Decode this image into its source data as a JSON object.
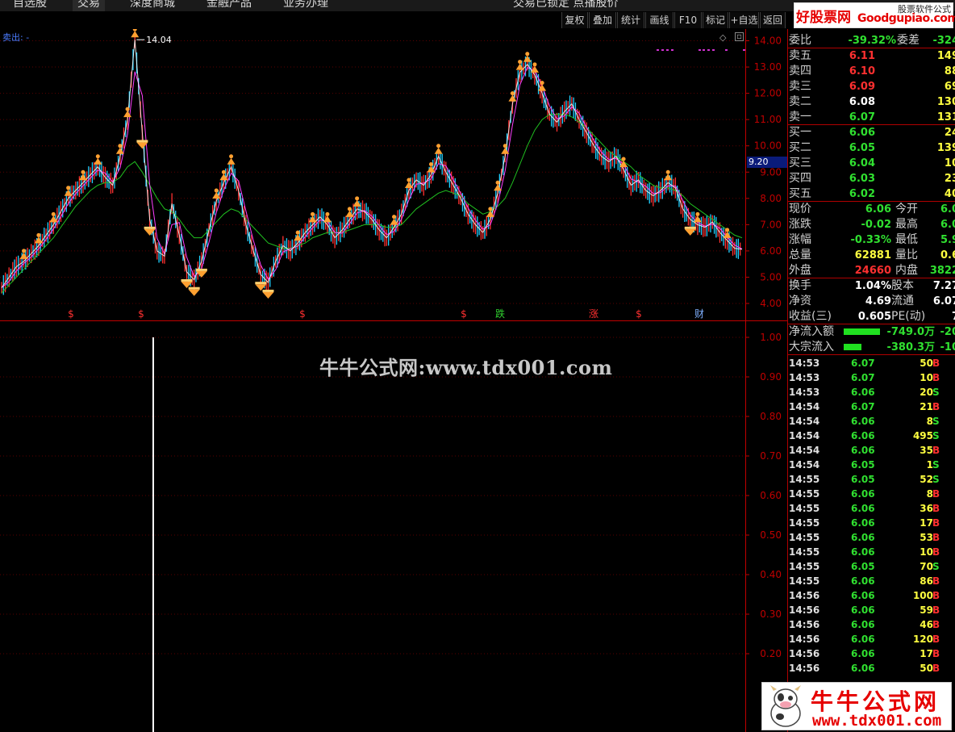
{
  "top_bar": {
    "tabs": [
      "自选股",
      "交易",
      "深度商城",
      "金融产品",
      "业务办理"
    ],
    "window_title": "交易已锁定   点播股价"
  },
  "toolbar": {
    "buttons": [
      "复权",
      "叠加",
      "统计",
      "画线",
      "F10",
      "标记",
      "+自选",
      "返回"
    ]
  },
  "main_chart": {
    "indicator_label": "卖出: -",
    "peak_label": "14.04",
    "current_price_tag": "9.20",
    "y_ticks": [
      "14.00",
      "13.00",
      "12.00",
      "11.00",
      "10.00",
      "9.00",
      "8.00",
      "7.00",
      "6.00",
      "5.00",
      "4.00"
    ],
    "event_markers": [
      {
        "label": "$",
        "color": "#ff3030"
      },
      {
        "label": "$",
        "color": "#ff3030"
      },
      {
        "label": "$",
        "color": "#ff3030"
      },
      {
        "label": "$",
        "color": "#ff3030"
      },
      {
        "label": "跌",
        "color": "#30d030"
      },
      {
        "label": "涨",
        "color": "#ff3030"
      },
      {
        "label": "$",
        "color": "#ff3030"
      },
      {
        "label": "财",
        "color": "#7fb0ff"
      }
    ]
  },
  "lower_chart": {
    "y_ticks": [
      "1.00",
      "0.90",
      "0.80",
      "0.70",
      "0.60",
      "0.50",
      "0.40",
      "0.30",
      "0.20"
    ]
  },
  "watermark": "牛牛公式网:www.tdx001.com",
  "logos": {
    "top_main": "好股票网",
    "top_site": "Goodgupiao.com",
    "top_tag": "股票软件公式",
    "bottom_main": "牛牛公式网",
    "bottom_site": "www.tdx001.com"
  },
  "quote": {
    "weibi": {
      "label": "委比",
      "value": "-39.32%",
      "label2": "委差",
      "value2": "-324"
    },
    "asks": [
      {
        "label": "卖五",
        "price": "6.11",
        "vol": "149"
      },
      {
        "label": "卖四",
        "price": "6.10",
        "vol": "88"
      },
      {
        "label": "卖三",
        "price": "6.09",
        "vol": "69"
      },
      {
        "label": "卖二",
        "price": "6.08",
        "vol": "130"
      },
      {
        "label": "卖一",
        "price": "6.07",
        "vol": "131"
      }
    ],
    "bids": [
      {
        "label": "买一",
        "price": "6.06",
        "vol": "24"
      },
      {
        "label": "买二",
        "price": "6.05",
        "vol": "139"
      },
      {
        "label": "买三",
        "price": "6.04",
        "vol": "10"
      },
      {
        "label": "买四",
        "price": "6.03",
        "vol": "23"
      },
      {
        "label": "买五",
        "price": "6.02",
        "vol": "40"
      }
    ],
    "stats": [
      {
        "l1": "现价",
        "v1": "6.06",
        "l2": "今开",
        "v2": "6.0"
      },
      {
        "l1": "涨跌",
        "v1": "-0.02",
        "l2": "最高",
        "v2": "6.0"
      },
      {
        "l1": "涨幅",
        "v1": "-0.33%",
        "l2": "最低",
        "v2": "5.9"
      },
      {
        "l1": "总量",
        "v1": "62881",
        "l2": "量比",
        "v2": "0.6"
      },
      {
        "l1": "外盘",
        "v1": "24660",
        "l2": "内盘",
        "v2": "3822"
      }
    ],
    "stats2": [
      {
        "l1": "换手",
        "v1": "1.04%",
        "l2": "股本",
        "v2": "7.27"
      },
      {
        "l1": "净资",
        "v1": "4.69",
        "l2": "流通",
        "v2": "6.07"
      },
      {
        "l1": "收益(三)",
        "v1": "0.605",
        "l2": "PE(动)",
        "v2": "7"
      }
    ],
    "flows": [
      {
        "label": "净流入额",
        "value": "-749.0万",
        "extra": "-20"
      },
      {
        "label": "大宗流入",
        "value": "-380.3万",
        "extra": "-10"
      }
    ]
  },
  "ticks": [
    {
      "time": "14:53",
      "price": "6.07",
      "vol": "50",
      "side": "B"
    },
    {
      "time": "14:53",
      "price": "6.07",
      "vol": "10",
      "side": "B"
    },
    {
      "time": "14:53",
      "price": "6.06",
      "vol": "20",
      "side": "S"
    },
    {
      "time": "14:54",
      "price": "6.07",
      "vol": "21",
      "side": "B"
    },
    {
      "time": "14:54",
      "price": "6.06",
      "vol": "8",
      "side": "S"
    },
    {
      "time": "14:54",
      "price": "6.06",
      "vol": "495",
      "side": "S"
    },
    {
      "time": "14:54",
      "price": "6.06",
      "vol": "35",
      "side": "B"
    },
    {
      "time": "14:54",
      "price": "6.05",
      "vol": "1",
      "side": "S"
    },
    {
      "time": "14:55",
      "price": "6.05",
      "vol": "52",
      "side": "S"
    },
    {
      "time": "14:55",
      "price": "6.06",
      "vol": "8",
      "side": "B"
    },
    {
      "time": "14:55",
      "price": "6.06",
      "vol": "36",
      "side": "B"
    },
    {
      "time": "14:55",
      "price": "6.06",
      "vol": "17",
      "side": "B"
    },
    {
      "time": "14:55",
      "price": "6.06",
      "vol": "53",
      "side": "B"
    },
    {
      "time": "14:55",
      "price": "6.06",
      "vol": "10",
      "side": "B"
    },
    {
      "time": "14:55",
      "price": "6.05",
      "vol": "70",
      "side": "S"
    },
    {
      "time": "14:55",
      "price": "6.06",
      "vol": "86",
      "side": "B"
    },
    {
      "time": "14:56",
      "price": "6.06",
      "vol": "100",
      "side": "B"
    },
    {
      "time": "14:56",
      "price": "6.06",
      "vol": "59",
      "side": "B"
    },
    {
      "time": "14:56",
      "price": "6.06",
      "vol": "46",
      "side": "B"
    },
    {
      "time": "14:56",
      "price": "6.06",
      "vol": "120",
      "side": "B"
    },
    {
      "time": "14:56",
      "price": "6.06",
      "vol": "17",
      "side": "B"
    },
    {
      "time": "14:56",
      "price": "6.06",
      "vol": "50",
      "side": "B"
    }
  ],
  "colors": {
    "up": "#ff3030",
    "down": "#30e030",
    "flat": "#ffffff",
    "buy": "#ff3030",
    "sell": "#30e030",
    "axis": "#c00000",
    "ma_green": "#20c020",
    "ma_pink": "#ff40ff",
    "ma_yellow": "#ffff30",
    "signal": "#ffa030"
  },
  "chart_data": {
    "type": "line",
    "title": "",
    "xlabel": "",
    "ylabel": "",
    "ylim": [
      4.0,
      14.2
    ],
    "grid": true,
    "series": [
      {
        "values": [
          4.6,
          5.0,
          5.4,
          5.6,
          5.9,
          6.2,
          6.6,
          7.0,
          7.5,
          8.0,
          8.3,
          8.6,
          8.9,
          9.2,
          8.8,
          8.5,
          9.6,
          11.0,
          14.04,
          10.5,
          7.2,
          6.0,
          5.8,
          7.8,
          6.6,
          5.2,
          4.9,
          5.6,
          6.8,
          7.9,
          8.6,
          9.2,
          8.3,
          7.0,
          6.0,
          5.1,
          4.8,
          5.6,
          6.2,
          6.0,
          6.3,
          6.7,
          7.0,
          7.3,
          7.0,
          6.5,
          6.8,
          7.2,
          7.6,
          7.5,
          7.2,
          6.8,
          6.5,
          6.9,
          7.4,
          8.3,
          8.7,
          8.5,
          8.9,
          9.6,
          9.0,
          8.5,
          8.0,
          7.4,
          7.0,
          6.7,
          7.2,
          8.2,
          9.6,
          11.6,
          12.8,
          13.1,
          12.7,
          12.0,
          11.2,
          10.9,
          11.3,
          11.6,
          11.0,
          10.5,
          10.0,
          9.6,
          9.4,
          9.6,
          9.1,
          8.5,
          8.7,
          8.3,
          8.1,
          8.3,
          8.6,
          8.4,
          7.6,
          7.2,
          7.0,
          6.9,
          7.1,
          6.7,
          6.4,
          6.1,
          6.06
        ]
      },
      {
        "values": [
          4.4,
          4.7,
          5.0,
          5.3,
          5.6,
          5.9,
          6.2,
          6.5,
          6.9,
          7.3,
          7.7,
          8.0,
          8.3,
          8.5,
          8.6,
          8.6,
          8.8,
          9.2,
          9.4,
          9.0,
          8.5,
          8.0,
          7.6,
          7.5,
          7.2,
          6.8,
          6.5,
          6.5,
          6.8,
          7.1,
          7.4,
          7.6,
          7.5,
          7.2,
          6.9,
          6.6,
          6.3,
          6.2,
          6.1,
          6.1,
          6.2,
          6.3,
          6.5,
          6.6,
          6.7,
          6.7,
          6.7,
          6.8,
          6.9,
          7.0,
          7.0,
          7.0,
          6.9,
          6.9,
          7.0,
          7.3,
          7.6,
          7.8,
          8.0,
          8.2,
          8.3,
          8.2,
          8.1,
          7.8,
          7.6,
          7.4,
          7.5,
          7.7,
          8.0,
          8.6,
          9.3,
          10.0,
          10.6,
          11.0,
          11.2,
          11.2,
          11.2,
          11.1,
          10.9,
          10.7,
          10.4,
          10.1,
          9.8,
          9.6,
          9.4,
          9.2,
          8.9,
          8.7,
          8.5,
          8.4,
          8.4,
          8.3,
          8.1,
          7.8,
          7.6,
          7.4,
          7.2,
          7.0,
          6.8,
          6.6,
          6.5
        ]
      }
    ]
  }
}
